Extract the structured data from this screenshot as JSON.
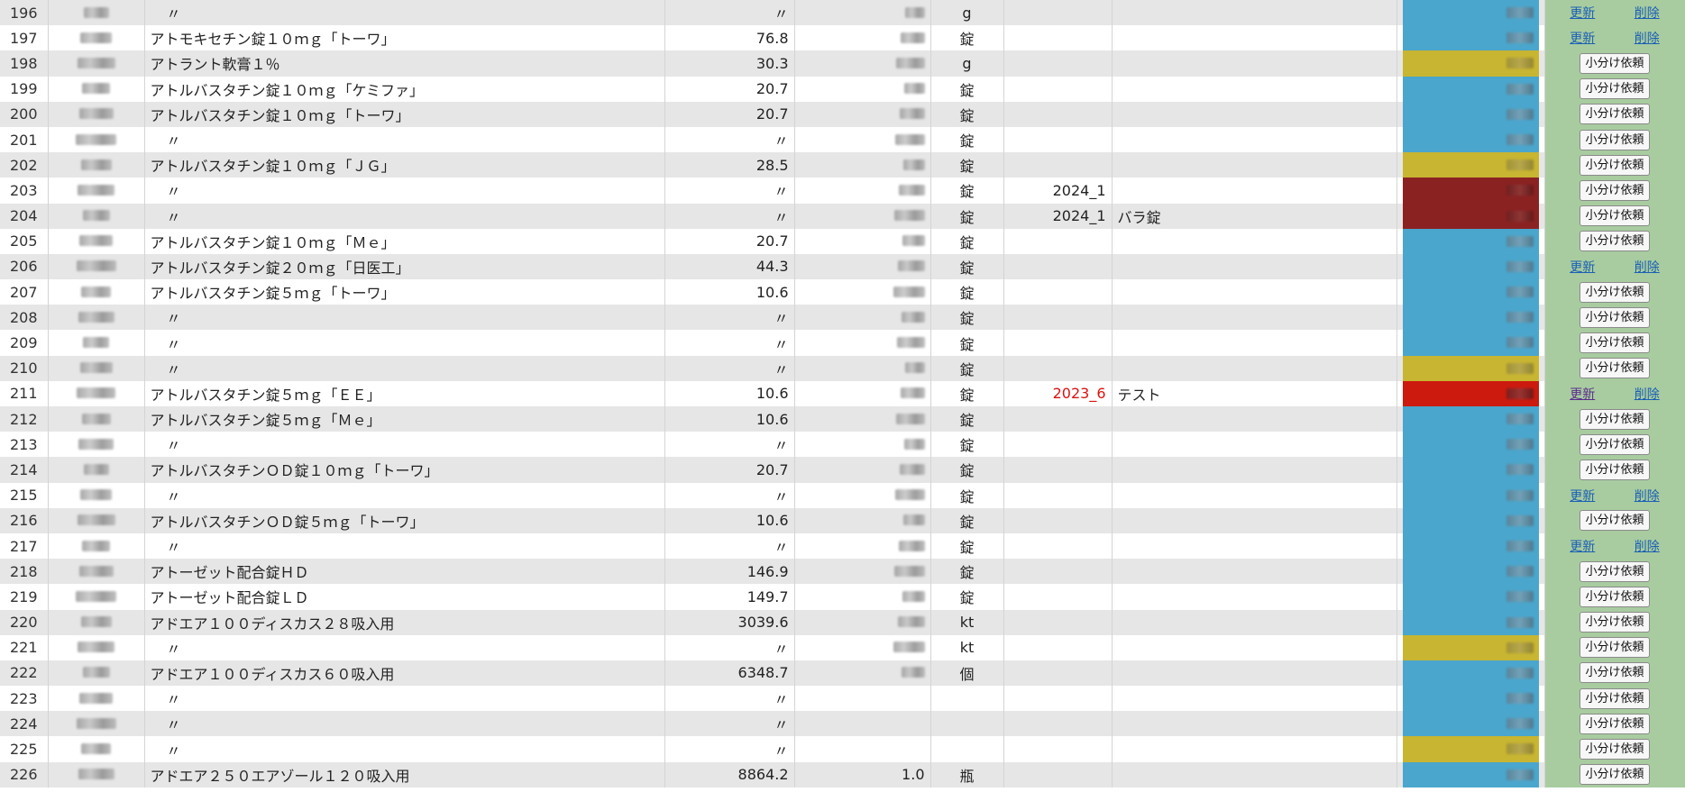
{
  "colors": {
    "status_blue": "#4aa6cc",
    "status_yellow": "#c8b531",
    "status_darkred": "#8b2222",
    "status_red": "#cc1a0f",
    "action_green": "#a8cca0",
    "row_alt": "#e6e6e6"
  },
  "labels": {
    "split_request": "小分け依頼",
    "update": "更新",
    "delete": "削除"
  },
  "rows": [
    {
      "no": "196",
      "name": "〃",
      "price": "〃",
      "unit": "g",
      "date": "",
      "note": "",
      "status": "blue",
      "action": "links",
      "date_red": false
    },
    {
      "no": "197",
      "name": "アトモキセチン錠１０ｍｇ「トーワ」",
      "price": "76.8",
      "unit": "錠",
      "date": "",
      "note": "",
      "status": "blue",
      "action": "links",
      "date_red": false
    },
    {
      "no": "198",
      "name": "アトラント軟膏１％",
      "price": "30.3",
      "unit": "g",
      "date": "",
      "note": "",
      "status": "yellow",
      "action": "button",
      "date_red": false
    },
    {
      "no": "199",
      "name": "アトルバスタチン錠１０ｍｇ「ケミファ」",
      "price": "20.7",
      "unit": "錠",
      "date": "",
      "note": "",
      "status": "blue",
      "action": "button",
      "date_red": false
    },
    {
      "no": "200",
      "name": "アトルバスタチン錠１０ｍｇ「トーワ」",
      "price": "20.7",
      "unit": "錠",
      "date": "",
      "note": "",
      "status": "blue",
      "action": "button",
      "date_red": false
    },
    {
      "no": "201",
      "name": "〃",
      "price": "〃",
      "unit": "錠",
      "date": "",
      "note": "",
      "status": "blue",
      "action": "button",
      "date_red": false
    },
    {
      "no": "202",
      "name": "アトルバスタチン錠１０ｍｇ「ＪＧ」",
      "price": "28.5",
      "unit": "錠",
      "date": "",
      "note": "",
      "status": "yellow",
      "action": "button",
      "date_red": false
    },
    {
      "no": "203",
      "name": "〃",
      "price": "〃",
      "unit": "錠",
      "date": "2024_1",
      "note": "",
      "status": "darkred",
      "action": "button",
      "date_red": false
    },
    {
      "no": "204",
      "name": "〃",
      "price": "〃",
      "unit": "錠",
      "date": "2024_1",
      "note": "バラ錠",
      "status": "darkred",
      "action": "button",
      "date_red": false
    },
    {
      "no": "205",
      "name": "アトルバスタチン錠１０ｍｇ「Ｍｅ」",
      "price": "20.7",
      "unit": "錠",
      "date": "",
      "note": "",
      "status": "blue",
      "action": "button",
      "date_red": false
    },
    {
      "no": "206",
      "name": "アトルバスタチン錠２０ｍｇ「日医工」",
      "price": "44.3",
      "unit": "錠",
      "date": "",
      "note": "",
      "status": "blue",
      "action": "links",
      "date_red": false
    },
    {
      "no": "207",
      "name": "アトルバスタチン錠５ｍｇ「トーワ」",
      "price": "10.6",
      "unit": "錠",
      "date": "",
      "note": "",
      "status": "blue",
      "action": "button",
      "date_red": false
    },
    {
      "no": "208",
      "name": "〃",
      "price": "〃",
      "unit": "錠",
      "date": "",
      "note": "",
      "status": "blue",
      "action": "button",
      "date_red": false
    },
    {
      "no": "209",
      "name": "〃",
      "price": "〃",
      "unit": "錠",
      "date": "",
      "note": "",
      "status": "blue",
      "action": "button",
      "date_red": false
    },
    {
      "no": "210",
      "name": "〃",
      "price": "〃",
      "unit": "錠",
      "date": "",
      "note": "",
      "status": "yellow",
      "action": "button",
      "date_red": false
    },
    {
      "no": "211",
      "name": "アトルバスタチン錠５ｍｇ「ＥＥ」",
      "price": "10.6",
      "unit": "錠",
      "date": "2023_6",
      "note": "テスト",
      "status": "red",
      "action": "links_visited",
      "date_red": true
    },
    {
      "no": "212",
      "name": "アトルバスタチン錠５ｍｇ「Ｍｅ」",
      "price": "10.6",
      "unit": "錠",
      "date": "",
      "note": "",
      "status": "blue",
      "action": "button",
      "date_red": false
    },
    {
      "no": "213",
      "name": "〃",
      "price": "〃",
      "unit": "錠",
      "date": "",
      "note": "",
      "status": "blue",
      "action": "button",
      "date_red": false
    },
    {
      "no": "214",
      "name": "アトルバスタチンＯＤ錠１０ｍｇ「トーワ」",
      "price": "20.7",
      "unit": "錠",
      "date": "",
      "note": "",
      "status": "blue",
      "action": "button",
      "date_red": false
    },
    {
      "no": "215",
      "name": "〃",
      "price": "〃",
      "unit": "錠",
      "date": "",
      "note": "",
      "status": "blue",
      "action": "links",
      "date_red": false
    },
    {
      "no": "216",
      "name": "アトルバスタチンＯＤ錠５ｍｇ「トーワ」",
      "price": "10.6",
      "unit": "錠",
      "date": "",
      "note": "",
      "status": "blue",
      "action": "button",
      "date_red": false
    },
    {
      "no": "217",
      "name": "〃",
      "price": "〃",
      "unit": "錠",
      "date": "",
      "note": "",
      "status": "blue",
      "action": "links",
      "date_red": false
    },
    {
      "no": "218",
      "name": "アトーゼット配合錠ＨＤ",
      "price": "146.9",
      "unit": "錠",
      "date": "",
      "note": "",
      "status": "blue",
      "action": "button",
      "date_red": false
    },
    {
      "no": "219",
      "name": "アトーゼット配合錠ＬＤ",
      "price": "149.7",
      "unit": "錠",
      "date": "",
      "note": "",
      "status": "blue",
      "action": "button",
      "date_red": false
    },
    {
      "no": "220",
      "name": "アドエア１００ディスカス２８吸入用",
      "price": "3039.6",
      "unit": "kt",
      "date": "",
      "note": "",
      "status": "blue",
      "action": "button",
      "date_red": false
    },
    {
      "no": "221",
      "name": "〃",
      "price": "〃",
      "unit": "kt",
      "date": "",
      "note": "",
      "status": "yellow",
      "action": "button",
      "date_red": false
    },
    {
      "no": "222",
      "name": "アドエア１００ディスカス６０吸入用",
      "price": "6348.7",
      "unit": "個",
      "date": "",
      "note": "",
      "status": "blue",
      "action": "button",
      "date_red": false
    },
    {
      "no": "223",
      "name": "〃",
      "price": "〃",
      "unit": "",
      "date": "",
      "note": "",
      "status": "blue",
      "action": "button",
      "date_red": false
    },
    {
      "no": "224",
      "name": "〃",
      "price": "〃",
      "unit": "",
      "date": "",
      "note": "",
      "status": "blue",
      "action": "button",
      "date_red": false
    },
    {
      "no": "225",
      "name": "〃",
      "price": "〃",
      "unit": "",
      "date": "",
      "note": "",
      "status": "yellow",
      "action": "button",
      "date_red": false
    },
    {
      "no": "226",
      "name": "アドエア２５０エアゾール１２０吸入用",
      "price": "8864.2",
      "qty": "1.0",
      "unit": "瓶",
      "date": "",
      "note": "",
      "status": "blue",
      "action": "button",
      "date_red": false
    }
  ]
}
